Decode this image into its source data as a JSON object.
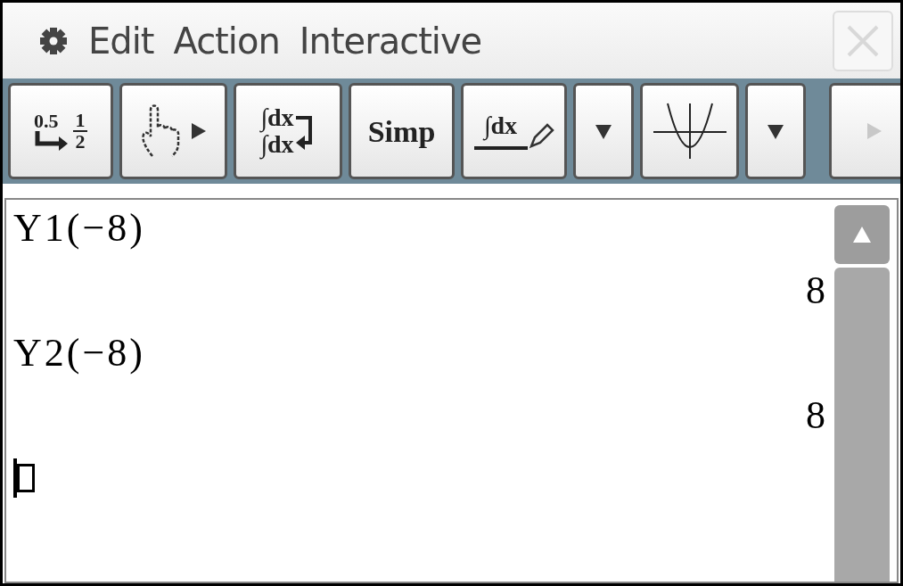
{
  "menu": {
    "items": [
      "Edit",
      "Action",
      "Interactive"
    ]
  },
  "close_button": {
    "disabled": true
  },
  "toolbar": [
    {
      "kind": "convert",
      "texts": [
        "0.5",
        "1",
        "2"
      ]
    },
    {
      "kind": "drag"
    },
    {
      "kind": "swap",
      "texts": [
        "∫dx",
        "∫dx"
      ]
    },
    {
      "kind": "text",
      "texts": [
        "Simp"
      ]
    },
    {
      "kind": "edit",
      "texts": [
        "∫dx"
      ]
    },
    {
      "kind": "dropdown"
    },
    {
      "kind": "graph"
    },
    {
      "kind": "dropdown"
    },
    {
      "kind": "next",
      "disabled": true
    }
  ],
  "work_area": {
    "entries": [
      {
        "input": "Y1(−8)",
        "output": "8"
      },
      {
        "input": "Y2(−8)",
        "output": "8"
      }
    ],
    "cursor": true
  }
}
